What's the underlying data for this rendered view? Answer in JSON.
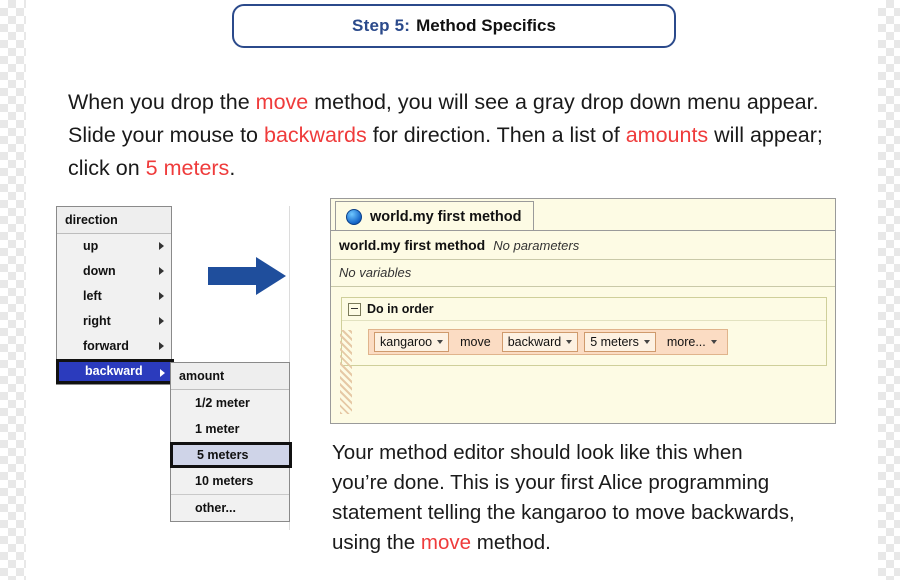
{
  "title": {
    "step": "Step 5:",
    "rest": "Method Specifics",
    "accent": "#2b4a8b"
  },
  "intro": {
    "p1": "When you drop the ",
    "kw1": "move",
    "p2": " method, you will see a gray drop down menu appear. Slide your mouse to ",
    "kw2": "backwards",
    "p3": " for direction. Then a list of ",
    "kw3": "amounts",
    "p4": " will appear; click on ",
    "kw4": "5 meters",
    "p5": ".",
    "highlight_color": "#ef3b3b"
  },
  "direction_menu": {
    "header": "direction",
    "items": [
      {
        "label": "up",
        "submenu": true,
        "selected": false
      },
      {
        "label": "down",
        "submenu": true,
        "selected": false
      },
      {
        "label": "left",
        "submenu": true,
        "selected": false
      },
      {
        "label": "right",
        "submenu": true,
        "selected": false
      },
      {
        "label": "forward",
        "submenu": true,
        "selected": false
      },
      {
        "label": "backward",
        "submenu": true,
        "selected": true
      }
    ],
    "selected_bg": "#2b3bbd"
  },
  "amount_menu": {
    "header": "amount",
    "items": [
      {
        "label": "1/2 meter",
        "selected": false
      },
      {
        "label": "1 meter",
        "selected": false
      },
      {
        "label": "5 meters",
        "selected": true
      },
      {
        "label": "10 meters",
        "selected": false
      },
      {
        "label": "other...",
        "selected": false
      }
    ],
    "selected_bg": "#cfd4e8"
  },
  "arrow": {
    "name": "right-arrow",
    "color": "#1f4e9c"
  },
  "editor": {
    "tab_label": "world.my first method",
    "method_name": "world.my first method",
    "method_params": "No parameters",
    "variables": "No variables",
    "do_in_order": "Do in order",
    "statement": [
      {
        "label": "kangaroo",
        "caret": true,
        "boxed": true
      },
      {
        "label": "move",
        "caret": false,
        "boxed": false
      },
      {
        "label": "backward",
        "caret": true,
        "boxed": true
      },
      {
        "label": "5 meters",
        "caret": true,
        "boxed": true
      },
      {
        "label": "more...",
        "caret": true,
        "boxed": false
      }
    ],
    "bg": "#fdfbe4",
    "statement_bg": "#fbdcc3"
  },
  "closing": {
    "p1": "Your method editor should look like this when you’re done. This is your first Alice programming statement telling the kangaroo to move backwards, using the ",
    "kw1": "move",
    "p2": " method."
  }
}
